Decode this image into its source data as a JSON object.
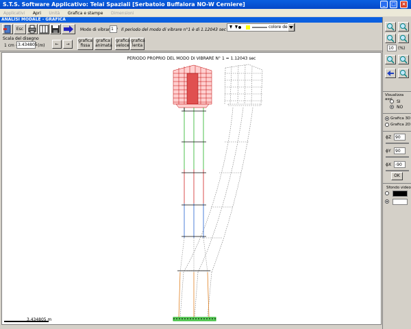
{
  "window": {
    "title": "S.T.S. Software Applicativo: Telai Spaziali [Serbatoio Buffalora NO-W Cerniere]",
    "buttons": [
      "_",
      "□",
      "×"
    ]
  },
  "menu": {
    "items": [
      {
        "label": "Applicativi",
        "disabled": true
      },
      {
        "label": "Apri",
        "disabled": false
      },
      {
        "label": "Unità",
        "disabled": true
      },
      {
        "label": "Grafica e stampe",
        "disabled": false
      },
      {
        "label": "Dimensioni",
        "disabled": true
      }
    ]
  },
  "panel_title": "ANALISI MODALE - GRAFICA",
  "toolbar": {
    "esc_label": "Esc",
    "mode_label": "Modo di vibrare n°",
    "mode_value": "1",
    "period_text": "Il periodo del modo di vibrare n°1 è di 1.12043 sec",
    "scale_label": "Scala del disegno",
    "scale_prefix": "1 cm =",
    "scale_value": "3.434805",
    "scale_unit": "(m)",
    "btn_fissa": "grafica fissa",
    "btn_animata": "grafica animata",
    "btn_veloce": "grafica veloce",
    "btn_lenta": "grafica lenta",
    "color_label": "colore dei",
    "arrow_left": "←",
    "arrow_right": "→"
  },
  "canvas": {
    "caption": "PERIODO PROPRIO DEL MODO DI VIBRARE N° 1 = 1.12043 sec",
    "scalebar_label": "3.434805 m"
  },
  "right_panel": {
    "zoom_value": "10",
    "zoom_unit": "(%)",
    "axes_title": "Visualizza assi",
    "axes_si": "SI",
    "axes_no": "NO",
    "axes_selected": "NO",
    "mode_3d": "Grafica 3D",
    "mode_2d": "Grafica 2D",
    "mode_selected": "Grafica 3D",
    "phi_z": "90",
    "phi_y": "90",
    "phi_x": "-90",
    "phi_z_label": "ɸZ",
    "phi_y_label": "ɸY",
    "phi_x_label": "ɸX",
    "ok": "OK",
    "bg_title": "Sfondo video",
    "bg_colors": [
      "#000000",
      "#ffffff"
    ]
  }
}
